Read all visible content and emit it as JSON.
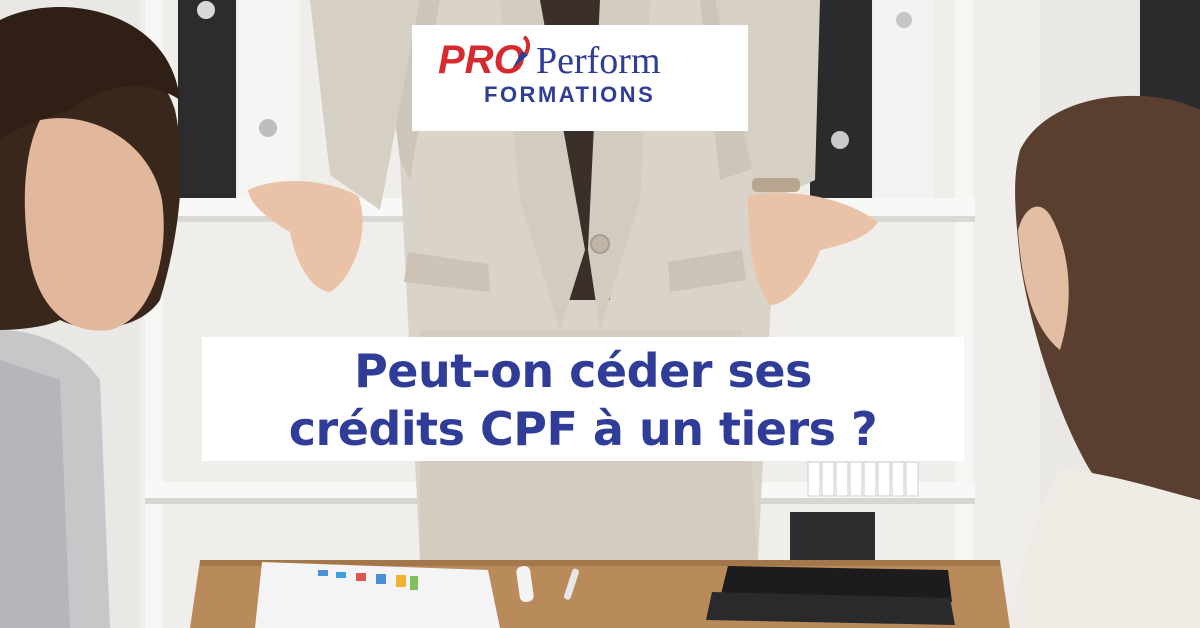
{
  "logo": {
    "word_pro": "PRO",
    "word_perform": "Perform",
    "word_formations": "FORMATIONS",
    "colors": {
      "pro": "#d72a2e",
      "perform": "#2f3d98",
      "formations": "#2f3d98"
    }
  },
  "headline": {
    "line1": "Peut-on céder ses",
    "line2": "crédits CPF à un tiers ?",
    "color": "#2f3d98"
  }
}
